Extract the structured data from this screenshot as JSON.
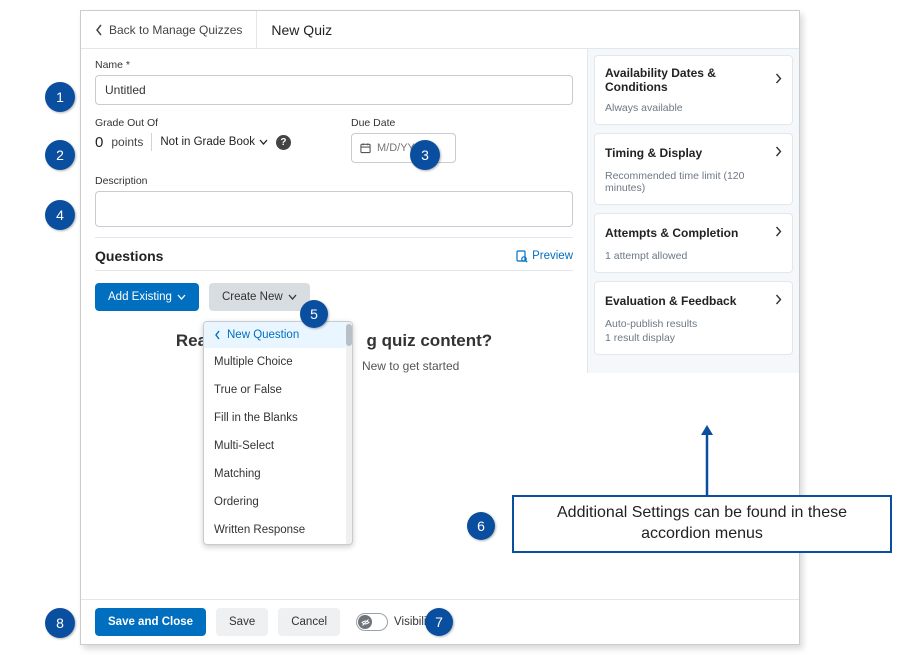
{
  "header": {
    "back_label": "Back to Manage Quizzes",
    "title": "New Quiz"
  },
  "form": {
    "name_label": "Name *",
    "name_value": "Untitled",
    "grade_label": "Grade Out Of",
    "points_value": "0",
    "points_unit": "points",
    "gradebook_label": "Not in Grade Book",
    "due_label": "Due Date",
    "due_placeholder": "M/D/YYYY",
    "desc_label": "Description"
  },
  "questions": {
    "heading": "Questions",
    "preview_label": "Preview",
    "add_existing": "Add Existing",
    "create_new": "Create New",
    "empty_title_a": "Rea",
    "empty_title_b": "g quiz content?",
    "empty_sub_b": "New to get started",
    "dropdown_header": "New Question",
    "options": [
      "Multiple Choice",
      "True or False",
      "Fill in the Blanks",
      "Multi-Select",
      "Matching",
      "Ordering",
      "Written Response"
    ]
  },
  "side": {
    "panels": [
      {
        "title": "Availability Dates & Conditions",
        "lines": [
          "Always available"
        ]
      },
      {
        "title": "Timing & Display",
        "lines": [
          "Recommended time limit (120 minutes)"
        ]
      },
      {
        "title": "Attempts & Completion",
        "lines": [
          "1 attempt allowed"
        ]
      },
      {
        "title": "Evaluation & Feedback",
        "lines": [
          "Auto-publish results",
          "1 result display"
        ]
      }
    ]
  },
  "footer": {
    "save_close": "Save and Close",
    "save": "Save",
    "cancel": "Cancel",
    "visibility": "Visibility"
  },
  "annotations": {
    "n1": "1",
    "n2": "2",
    "n3": "3",
    "n4": "4",
    "n5": "5",
    "n6": "6",
    "n7": "7",
    "n8": "8"
  },
  "callout": "Additional Settings can be found in these accordion menus"
}
